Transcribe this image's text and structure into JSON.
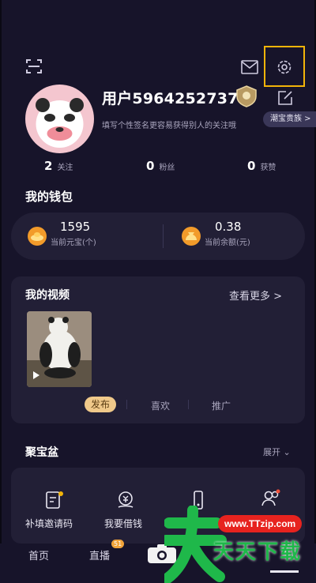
{
  "profile": {
    "username": "用户5964252737",
    "bio": "填写个性签名更容易获得别人的关注哦",
    "fans_pill": "潮宝贵族 >"
  },
  "stats": [
    {
      "num": "2",
      "label": "关注"
    },
    {
      "num": "0",
      "label": "粉丝"
    },
    {
      "num": "0",
      "label": "获赞"
    }
  ],
  "wallet": {
    "title": "我的钱包",
    "balance_value": "1595",
    "balance_label": "当前元宝(个)",
    "cash_value": "0.38",
    "cash_label": "当前余额(元)"
  },
  "videos": {
    "title": "我的视频",
    "more": "查看更多 >",
    "tabs": [
      "发布",
      "喜欢",
      "推广"
    ]
  },
  "tools": {
    "title": "聚宝盆",
    "expand": "展开",
    "items": [
      "补填邀请码",
      "我要借钱",
      "手机",
      ""
    ]
  },
  "nav": {
    "items": [
      "首页",
      "直播",
      "",
      ""
    ],
    "live_badge": "51"
  },
  "watermark": {
    "url": "www.TTzip.com",
    "text": "天天下载"
  },
  "colors": {
    "background": "#17142a",
    "card": "#221f36",
    "accent_gold": "#f2b409",
    "tab_active": "#f0c98a"
  }
}
